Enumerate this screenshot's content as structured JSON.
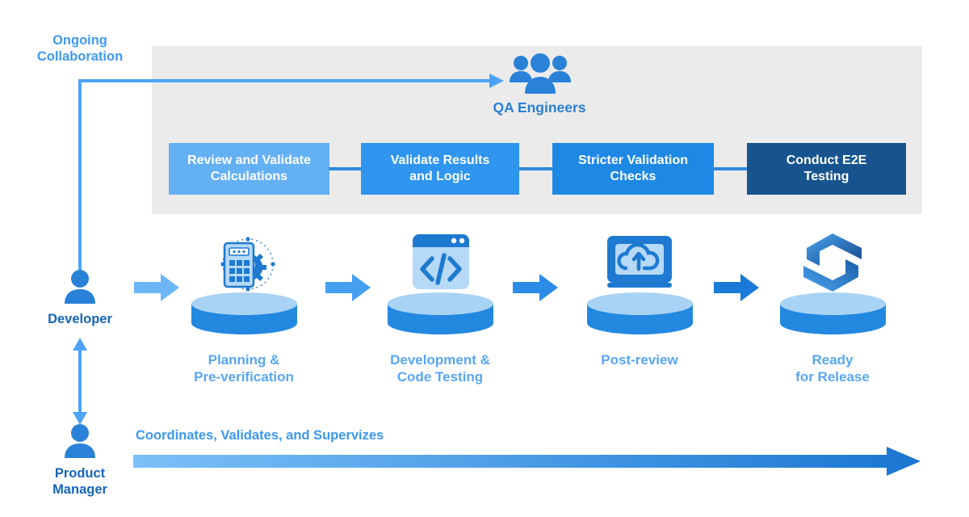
{
  "diagram": {
    "title_text_present": false,
    "colors": {
      "panel_bg": "#ebebeb",
      "accent_light": "#64b0f5",
      "accent": "#2f95ef",
      "accent_mid": "#1e88e5",
      "accent_dark": "#17548f",
      "label_blue": "#58a6f5",
      "role_blue": "#1565b8"
    }
  },
  "ongoing": {
    "label": "Ongoing\nCollaboration",
    "arrow_icon": "arrow-right-icon"
  },
  "qa": {
    "label": "QA Engineers",
    "icon": "people-group-icon",
    "steps": [
      {
        "label": "Review and Validate\nCalculations",
        "color": "#64b0f5"
      },
      {
        "label": "Validate Results\nand Logic",
        "color": "#2f95ef"
      },
      {
        "label": "Stricter Validation\nChecks",
        "color": "#1e88e5"
      },
      {
        "label": "Conduct E2E\nTesting",
        "color": "#17548f"
      }
    ]
  },
  "roles": {
    "developer": {
      "label": "Developer",
      "icon": "person-icon"
    },
    "product_manager": {
      "label": "Product\nManager",
      "icon": "person-icon"
    }
  },
  "pipeline": {
    "stages": [
      {
        "label": "Planning &\nPre-verification",
        "icon": "calculator-gear-icon"
      },
      {
        "label": "Development &\nCode Testing",
        "icon": "code-window-icon"
      },
      {
        "label": "Post-review",
        "icon": "monitor-cloud-upload-icon"
      },
      {
        "label": "Ready\nfor Release",
        "icon": "hexagon-s-logo-icon"
      }
    ],
    "arrows": [
      {
        "icon": "arrow-right-icon",
        "color": "#6cb6f7"
      },
      {
        "icon": "arrow-right-icon",
        "color": "#46a0f2"
      },
      {
        "icon": "arrow-right-icon",
        "color": "#2b8ce8"
      },
      {
        "icon": "arrow-right-icon",
        "color": "#1a7ad8"
      }
    ]
  },
  "supervision": {
    "label": "Coordinates, Validates, and Supervizes",
    "arrow_icon": "gradient-arrow-right-icon",
    "gradient_from": "#7cc0f8",
    "gradient_to": "#1976d2"
  }
}
